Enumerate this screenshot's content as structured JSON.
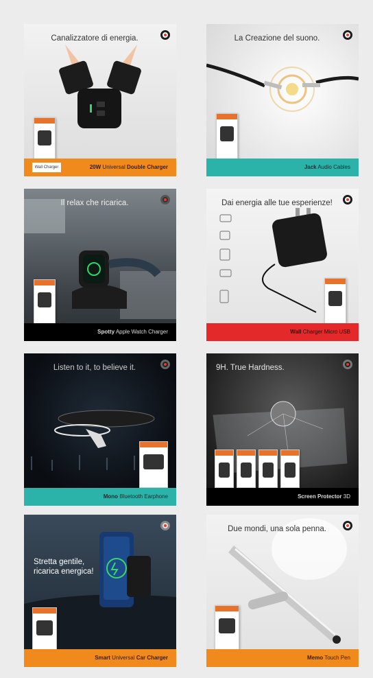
{
  "cards": [
    {
      "headline": "Canalizzatore di energia.",
      "caption_bold1": "20W",
      "caption_light": " Universal ",
      "caption_bold2": "Double Charger",
      "stamp": "Wall Charger"
    },
    {
      "headline": "La Creazione del suono.",
      "caption_bold1": "Jack",
      "caption_light": " Audio Cables",
      "caption_bold2": ""
    },
    {
      "headline": "Il relax che ricarica.",
      "caption_bold1": "Spotty",
      "caption_light": " Apple Watch Charger",
      "caption_bold2": ""
    },
    {
      "headline": "Dai energia alle tue esperienze!",
      "caption_bold1": "Wall",
      "caption_light": " Charger Micro USB",
      "caption_bold2": ""
    },
    {
      "headline": "Listen to it, to believe it.",
      "caption_bold1": "Mono",
      "caption_light": " Bluetooth Earphone",
      "caption_bold2": ""
    },
    {
      "headline": "9H. True Hardness.",
      "caption_bold1": "Screen Protector",
      "caption_light": " 3D",
      "caption_bold2": ""
    },
    {
      "headline": "Stretta gentile, ricarica energica!",
      "caption_bold1": "Smart",
      "caption_light": " Universal ",
      "caption_bold2": "Car Charger"
    },
    {
      "headline": "Due mondi, una sola penna.",
      "caption_bold1": "Memo",
      "caption_light": " Touch Pen",
      "caption_bold2": ""
    }
  ],
  "colors": {
    "orange": "#f08a1c",
    "teal": "#2bb3a9",
    "red": "#e3292a",
    "black": "#000000"
  }
}
